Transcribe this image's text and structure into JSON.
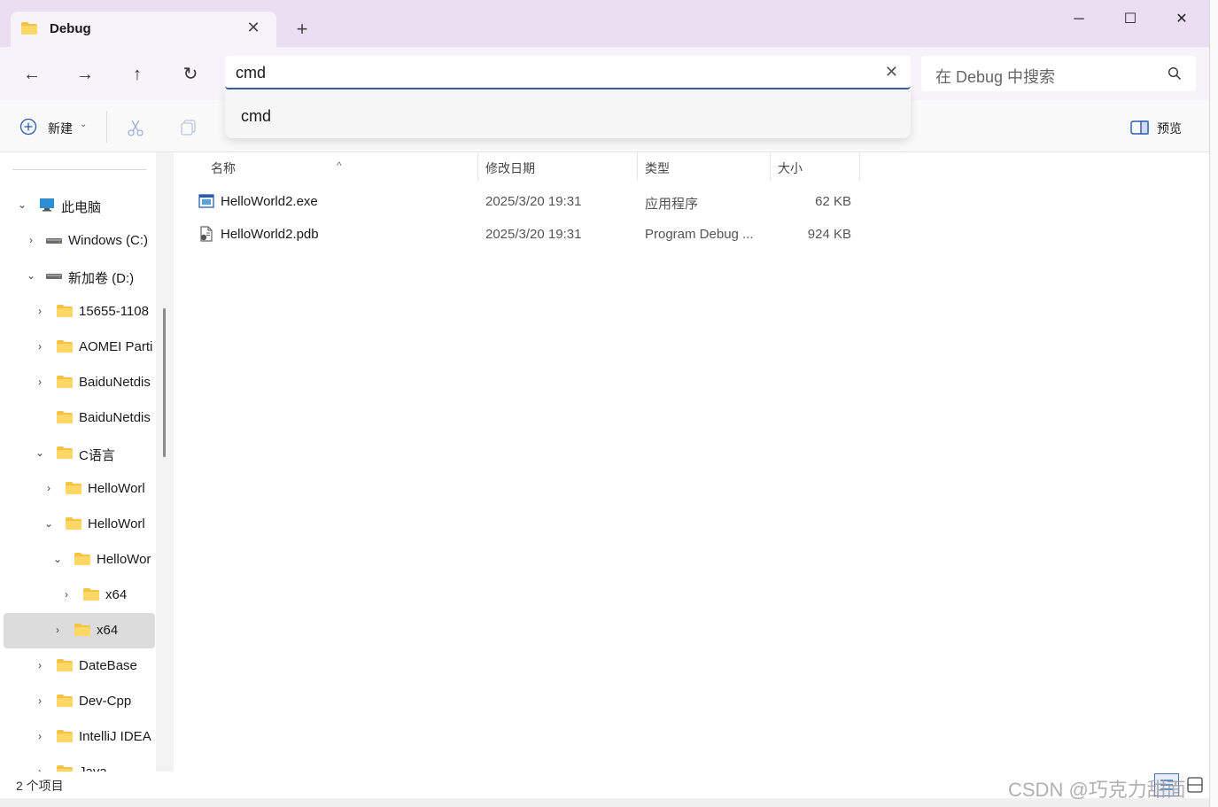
{
  "tab": {
    "title": "Debug",
    "close": "✕",
    "new": "+"
  },
  "window_controls": {
    "minimize": "─",
    "maximize": "☐",
    "close": "✕"
  },
  "nav": {
    "back": "←",
    "forward": "→",
    "up": "↑",
    "refresh": "↻"
  },
  "address": {
    "value": "cmd",
    "clear": "✕"
  },
  "search": {
    "placeholder": "在 Debug 中搜索"
  },
  "dropdown": {
    "items": [
      "cmd"
    ]
  },
  "toolbar": {
    "new_label": "新建",
    "new_caret": "⌄",
    "preview_label": "预览"
  },
  "sidebar": {
    "items": [
      {
        "label": "此电脑",
        "chevron": "⌄",
        "icon": "computer-icon"
      },
      {
        "label": "Windows (C:)",
        "chevron": "›",
        "icon": "drive-icon"
      },
      {
        "label": "新加卷 (D:)",
        "chevron": "⌄",
        "icon": "drive-icon"
      },
      {
        "label": "15655-1108",
        "chevron": "›",
        "icon": "folder-icon"
      },
      {
        "label": "AOMEI Parti",
        "chevron": "›",
        "icon": "folder-icon"
      },
      {
        "label": "BaiduNetdis",
        "chevron": "›",
        "icon": "folder-icon"
      },
      {
        "label": "BaiduNetdis",
        "chevron": "",
        "icon": "folder-icon"
      },
      {
        "label": "C语言",
        "chevron": "⌄",
        "icon": "folder-icon"
      },
      {
        "label": "HelloWorl",
        "chevron": "›",
        "icon": "folder-icon"
      },
      {
        "label": "HelloWorl",
        "chevron": "⌄",
        "icon": "folder-icon"
      },
      {
        "label": "HelloWor",
        "chevron": "⌄",
        "icon": "folder-icon"
      },
      {
        "label": "x64",
        "chevron": "›",
        "icon": "folder-icon"
      },
      {
        "label": "x64",
        "chevron": "›",
        "icon": "folder-icon",
        "selected": true
      },
      {
        "label": "DateBase",
        "chevron": "›",
        "icon": "folder-icon"
      },
      {
        "label": "Dev-Cpp",
        "chevron": "›",
        "icon": "folder-icon"
      },
      {
        "label": "IntelliJ IDEA",
        "chevron": "›",
        "icon": "folder-icon"
      },
      {
        "label": "Java",
        "chevron": "›",
        "icon": "folder-icon"
      }
    ]
  },
  "columns": {
    "name": "名称",
    "modified": "修改日期",
    "type": "类型",
    "size": "大小",
    "sort_indicator": "^"
  },
  "files": [
    {
      "name": "HelloWorld2.exe",
      "modified": "2025/3/20 19:31",
      "type": "应用程序",
      "size": "62 KB",
      "icon": "exe-icon"
    },
    {
      "name": "HelloWorld2.pdb",
      "modified": "2025/3/20 19:31",
      "type": "Program Debug ...",
      "size": "924 KB",
      "icon": "pdb-file-icon"
    }
  ],
  "status": {
    "item_count": "2 个项目"
  },
  "watermark": "CSDN @巧克力甜面",
  "colors": {
    "titlebar": "#e9def2",
    "accent": "#3b5aa3",
    "folder": "#f5c242"
  }
}
